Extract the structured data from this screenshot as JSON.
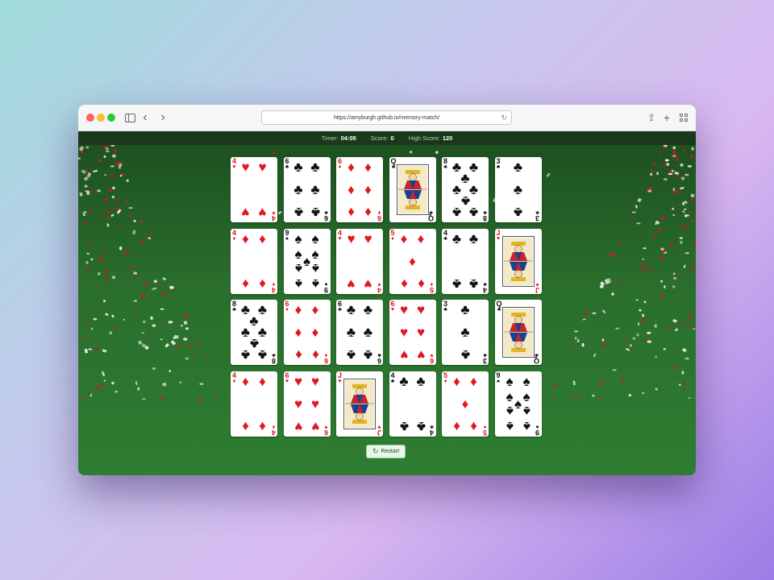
{
  "browser": {
    "url": "https://amyburgh.github.io/memory-match/",
    "icons": {
      "sidebar": "sidebar-icon",
      "back": "chevron-left-icon",
      "forward": "chevron-right-icon",
      "reload": "reload-icon",
      "share": "share-icon",
      "new_tab": "plus-icon",
      "tabs": "tab-overview-icon"
    }
  },
  "stats": {
    "timer_label": "Timer:",
    "timer_value": "04:05",
    "score_label": "Score:",
    "score_value": "0",
    "high_score_label": "High Score:",
    "high_score_value": "120"
  },
  "colors": {
    "felt": "#2e7d32",
    "felt_dark": "#183a19",
    "red_suit": "#e0191f",
    "black_suit": "#111111"
  },
  "cards": [
    {
      "rank": "4",
      "suit": "hearts"
    },
    {
      "rank": "6",
      "suit": "clubs"
    },
    {
      "rank": "6",
      "suit": "diamonds"
    },
    {
      "rank": "Q",
      "suit": "clubs"
    },
    {
      "rank": "8",
      "suit": "clubs"
    },
    {
      "rank": "3",
      "suit": "clubs"
    },
    {
      "rank": "4",
      "suit": "diamonds"
    },
    {
      "rank": "9",
      "suit": "spades"
    },
    {
      "rank": "4",
      "suit": "hearts"
    },
    {
      "rank": "5",
      "suit": "diamonds"
    },
    {
      "rank": "4",
      "suit": "clubs"
    },
    {
      "rank": "J",
      "suit": "hearts"
    },
    {
      "rank": "8",
      "suit": "clubs"
    },
    {
      "rank": "6",
      "suit": "diamonds"
    },
    {
      "rank": "6",
      "suit": "clubs"
    },
    {
      "rank": "6",
      "suit": "hearts"
    },
    {
      "rank": "3",
      "suit": "clubs"
    },
    {
      "rank": "Q",
      "suit": "clubs"
    },
    {
      "rank": "4",
      "suit": "diamonds"
    },
    {
      "rank": "6",
      "suit": "hearts"
    },
    {
      "rank": "J",
      "suit": "hearts"
    },
    {
      "rank": "4",
      "suit": "clubs"
    },
    {
      "rank": "5",
      "suit": "diamonds"
    },
    {
      "rank": "9",
      "suit": "spades"
    }
  ],
  "restart": {
    "label": "Restart",
    "icon": "refresh-icon"
  }
}
